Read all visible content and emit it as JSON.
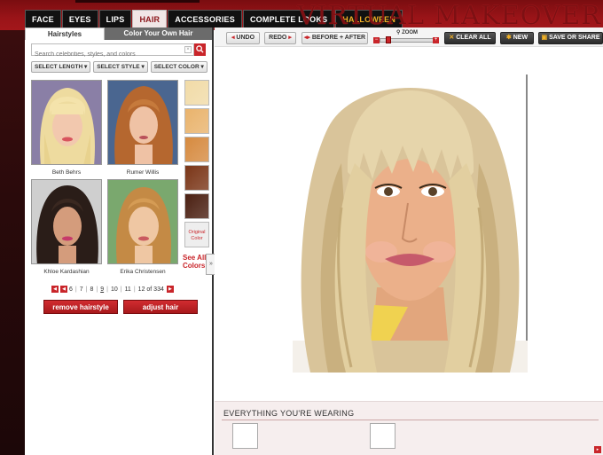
{
  "brand": "VIRTUAL MAKEOVER",
  "nav": {
    "tabs": [
      "FACE",
      "EYES",
      "LIPS",
      "HAIR",
      "ACCESSORIES",
      "COMPLETE LOOKS",
      "HALLOWEEN"
    ],
    "active": "HAIR"
  },
  "panel": {
    "subtabs": [
      "Hairstyles",
      "Color Your Own Hair"
    ],
    "search_placeholder": "Search celebrities, styles, and colors",
    "search_icon": "magnifier-icon",
    "filters": [
      "SELECT LENGTH ▾",
      "SELECT STYLE ▾",
      "SELECT COLOR ▾"
    ],
    "styles": [
      {
        "name": "Beth Behrs"
      },
      {
        "name": "Rumer Willis"
      },
      {
        "name": "Khloe Kardashian"
      },
      {
        "name": "Erika Christensen"
      }
    ],
    "swatch_colors": [
      "#f1dba7",
      "#e9b36c",
      "#d68a3f",
      "#7a3517",
      "#4a1f11"
    ],
    "original_color_label": "Original Color",
    "see_all": "See All Colors",
    "collapse": "»",
    "pager": {
      "pages": [
        "6",
        "7",
        "8",
        "9",
        "10",
        "11"
      ],
      "current": "9",
      "summary": "12 of 334"
    },
    "remove_button": "remove hairstyle",
    "adjust_button": "adjust hair"
  },
  "toolbar": {
    "undo": "UNDO",
    "redo": "REDO",
    "before_after": "BEFORE + AFTER",
    "zoom_label": "ZOOM",
    "zoom_level": 0.1,
    "clear_all": "CLEAR ALL",
    "new": "NEW",
    "save_share": "SAVE OR SHARE"
  },
  "wearing": {
    "title": "EVERYTHING YOU'RE WEARING"
  },
  "colors": {
    "accent": "#c9252a",
    "brand_red": "#9a1418"
  }
}
